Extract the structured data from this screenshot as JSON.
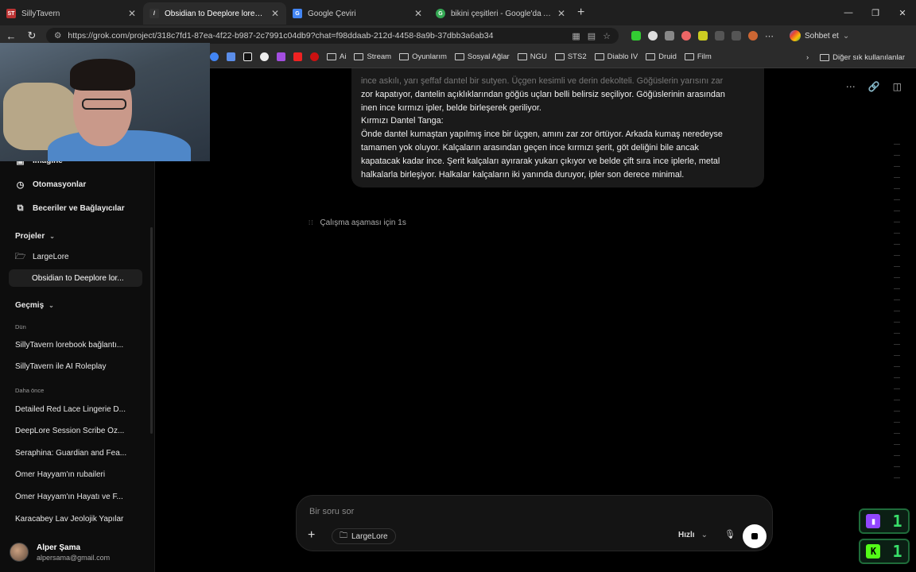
{
  "browser": {
    "tabs": [
      {
        "title": "SillyTavern",
        "favicon": "ST",
        "color": "#b33"
      },
      {
        "title": "Obsidian to Deeplore lore convers",
        "favicon": "/",
        "color": "#333"
      },
      {
        "title": "Google Çeviri",
        "favicon": "G",
        "color": "#4285f4"
      },
      {
        "title": "bikini çeşitleri - Google'da Ara",
        "favicon": "G",
        "color": "#34a853"
      }
    ],
    "url": "https://grok.com/project/318c7fd1-87ea-4f22-b987-2c7991c04db9?chat=f98ddaab-212d-4458-8a9b-37dbb3a6ab34",
    "sohbet_label": "Sohbet et",
    "bookmarks": [
      {
        "label": "Ai",
        "folder": true
      },
      {
        "label": "Stream",
        "folder": true
      },
      {
        "label": "Oyunlarım",
        "folder": true
      },
      {
        "label": "Sosyal Ağlar",
        "folder": true
      },
      {
        "label": "NGU",
        "folder": true
      },
      {
        "label": "STS2",
        "folder": true
      },
      {
        "label": "Diablo IV",
        "folder": true
      },
      {
        "label": "Druid",
        "folder": true
      },
      {
        "label": "Film",
        "folder": true
      }
    ],
    "other_bookmarks": "Diğer sık kullanılanlar"
  },
  "sidebar": {
    "imagine": "Imagine",
    "automations": "Otomasyonlar",
    "skills": "Beceriler ve Bağlayıcılar",
    "projects_label": "Projeler",
    "project_name": "LargeLore",
    "project_chat": "Obsidian to Deeplore lor...",
    "history_label": "Geçmiş",
    "yesterday_label": "Dün",
    "yesterday": [
      "SillyTavern lorebook bağlantı...",
      "SillyTavern ile AI Roleplay"
    ],
    "earlier_label": "Daha önce",
    "earlier": [
      "Detailed Red Lace Lingerie D...",
      "DeepLore Session Scribe Öz...",
      "Seraphina: Guardian and Fea...",
      "Ömer Hayyam'ın rubaileri",
      "Ömer Hayyam'ın Hayatı ve F...",
      "Karacabey Lav Jeolojik Yapılar"
    ],
    "user_name": "Alper Şama",
    "user_email": "alpersama@gmail.com"
  },
  "chat": {
    "message_faded": "ince askılı, yarı şeffaf dantel bir sutyen. Üçgen kesimli ve derin dekolteli. Göğüslerin yarısını zar",
    "message_lines": [
      "zor kapatıyor, dantelin açıklıklarından göğüs uçları belli belirsiz seçiliyor. Göğüslerinin arasından",
      "inen ince kırmızı ipler, belde birleşerek geriliyor.",
      "Kırmızı Dantel Tanga:",
      "Önde dantel kumaştan yapılmış ince bir üçgen, amını zar zor örtüyor. Arkada kumaş neredeyse",
      "tamamen yok oluyor. Kalçaların arasından geçen ince kırmızı şerit, göt deliğini bile ancak",
      "kapatacak kadar ince. Şerit kalçaları ayırarak yukarı çıkıyor ve belde çift sıra ince iplerle, metal",
      "halkalarla birleşiyor. Halkalar kalçaların iki yanında duruyor, ipler son derece minimal."
    ],
    "thinking": "Çalışma aşaması için 1s"
  },
  "composer": {
    "placeholder": "Bir soru sor",
    "project_chip": "LargeLore",
    "mode": "Hızlı",
    "mode_chevron": "⌄"
  },
  "overlays": [
    {
      "icon": "twitch-icon",
      "count": "1",
      "color": "#9146ff"
    },
    {
      "icon": "kick-icon",
      "count": "1",
      "color": "#53fc18"
    }
  ]
}
